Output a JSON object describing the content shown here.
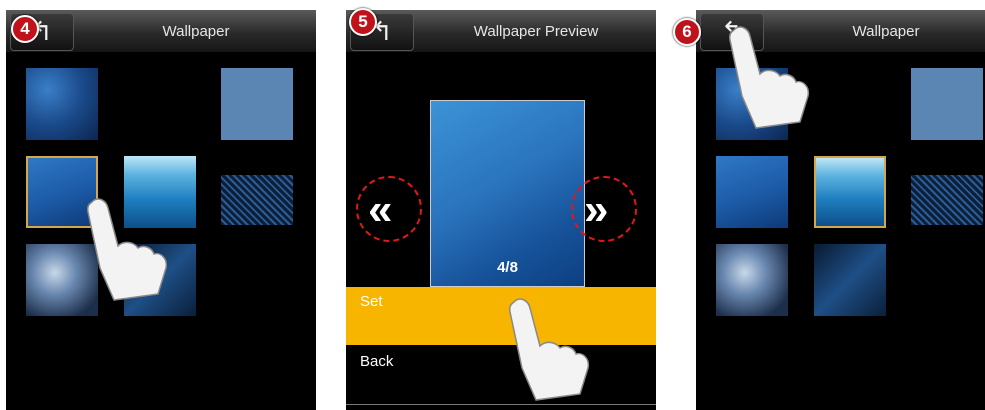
{
  "panels": [
    {
      "step": "4",
      "title": "Wallpaper"
    },
    {
      "step": "5",
      "title": "Wallpaper Preview",
      "preview_counter": "4/8",
      "menu": {
        "set_label": "Set",
        "back_label": "Back"
      },
      "prev_icon": "double-chevron-left-icon",
      "next_icon": "double-chevron-right-icon"
    },
    {
      "step": "6",
      "title": "Wallpaper"
    }
  ],
  "colors": {
    "badge": "#c0121a",
    "highlight_ring": "#e01818",
    "selected_menu": "#f7b500",
    "selected_thumb_border": "#d6a74a"
  },
  "back_icon": "back-arrow-icon",
  "pointer_icon": "hand-pointer-icon"
}
